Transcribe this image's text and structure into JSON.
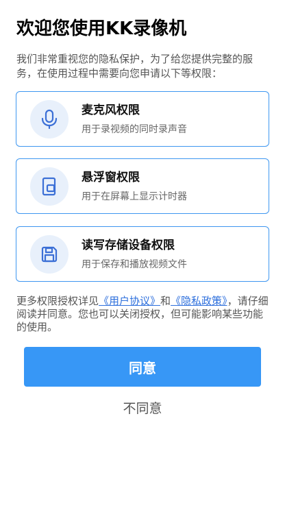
{
  "header": {
    "title": "欢迎您使用KK录像机",
    "intro": "我们非常重视您的隐私保护，为了给您提供完整的服务，在使用过程中需要向您申请以下等权限："
  },
  "permissions": [
    {
      "icon": "microphone-icon",
      "title": "麦克风权限",
      "desc": "用于录视频的同时录声音"
    },
    {
      "icon": "floating-window-icon",
      "title": "悬浮窗权限",
      "desc": "用于在屏幕上显示计时器"
    },
    {
      "icon": "storage-icon",
      "title": "读写存储设备权限",
      "desc": "用于保存和播放视频文件"
    }
  ],
  "policy": {
    "prefix": "更多权限授权详见",
    "user_agreement": "《用户协议》",
    "and": "和",
    "privacy_policy": "《隐私政策》",
    "suffix": "，请仔细阅读并同意。您也可以关闭授权，但可能影响某些功能的使用。"
  },
  "buttons": {
    "agree": "同意",
    "disagree": "不同意"
  },
  "colors": {
    "accent": "#3797f6",
    "card_border": "#3d96f0",
    "icon_bg": "#e8f0fb",
    "icon_stroke": "#3b6fd6",
    "link": "#2d6fdc"
  }
}
